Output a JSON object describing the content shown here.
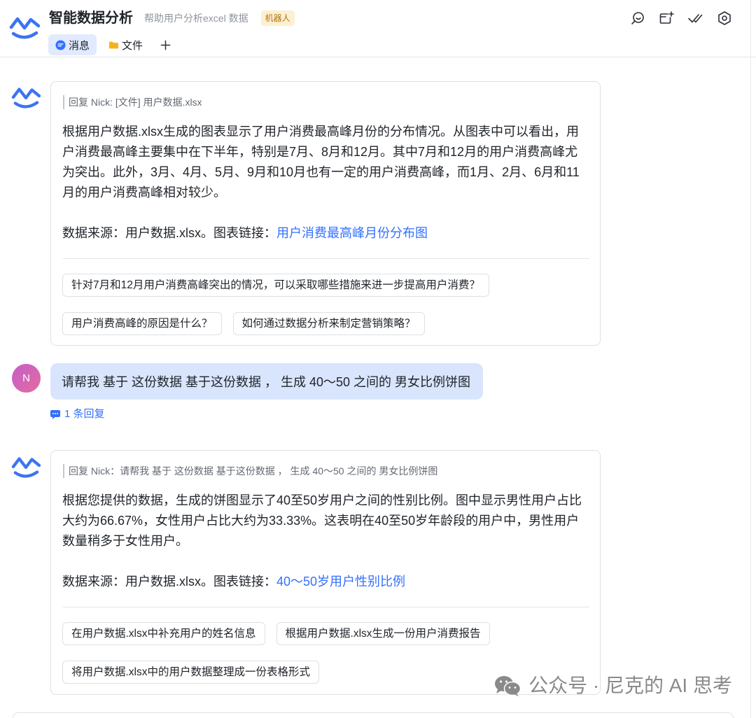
{
  "header": {
    "title": "智能数据分析",
    "subtitle": "帮助用户分析excel 数据",
    "badge": "机器人",
    "logo_icon": "bot-logo-icon",
    "actions": [
      {
        "icon": "search-chat-icon"
      },
      {
        "icon": "new-window-icon"
      },
      {
        "icon": "mark-done-icon"
      },
      {
        "icon": "settings-icon"
      }
    ]
  },
  "tabs": [
    {
      "label": "消息",
      "icon": "message-icon",
      "active": true
    },
    {
      "label": "文件",
      "icon": "folder-icon",
      "active": false
    }
  ],
  "add_tab_icon": "plus-icon",
  "messages": [
    {
      "avatar_icon": "bot-logo-icon",
      "quote": "回复 Nick: [文件] 用户数据.xlsx",
      "body": "根据用户数据.xlsx生成的图表显示了用户消费最高峰月份的分布情况。从图表中可以看出，用户消费最高峰主要集中在下半年，特别是7月、8月和12月。其中7月和12月的用户消费高峰尤为突出。此外，3月、4月、5月、9月和10月也有一定的用户消费高峰，而1月、2月、6月和11月的用户消费高峰相对较少。",
      "source_prefix": "数据来源：用户数据.xlsx。图表链接：",
      "source_link": "用户消费最高峰月份分布图",
      "suggestions": [
        "针对7月和12月用户消费高峰突出的情况，可以采取哪些措施来进一步提高用户消费？",
        "用户消费高峰的原因是什么？",
        "如何通过数据分析来制定营销策略？"
      ]
    },
    {
      "avatar_letter": "N",
      "text": "请帮我 基于 这份数据 基于这份数据 ， 生成 40～50 之间的 男女比例饼图",
      "reply_icon": "reply-icon",
      "reply_count": "1 条回复"
    },
    {
      "avatar_icon": "bot-logo-icon",
      "quote": "回复 Nick：请帮我 基于 这份数据 基于这份数据 ， 生成 40～50 之间的 男女比例饼图",
      "body": "根据您提供的数据，生成的饼图显示了40至50岁用户之间的性别比例。图中显示男性用户占比大约为66.67%，女性用户占比大约为33.33%。这表明在40至50岁年龄段的用户中，男性用户数量稍多于女性用户。",
      "source_prefix": "数据来源：用户数据.xlsx。图表链接：",
      "source_link": "40～50岁用户性别比例",
      "suggestions": [
        "在用户数据.xlsx中补充用户的姓名信息",
        "根据用户数据.xlsx生成一份用户消费报告",
        "将用户数据.xlsx中的用户数据整理成一份表格形式"
      ]
    }
  ],
  "watermark": "公众号 · 尼克的 AI 思考",
  "watermark_icon": "wechat-icon",
  "colors": {
    "accent": "#3370ff",
    "logo": "#3b74f2",
    "tab_active_bg": "#e1eaff",
    "badge_bg": "#fcf0d2",
    "badge_text": "#b5730f",
    "user_bubble": "#d9e5fd",
    "avatar_start": "#c45fc9",
    "avatar_end": "#e46b9e",
    "folder": "#f5b31b",
    "watermark": "#8a8a8a"
  }
}
